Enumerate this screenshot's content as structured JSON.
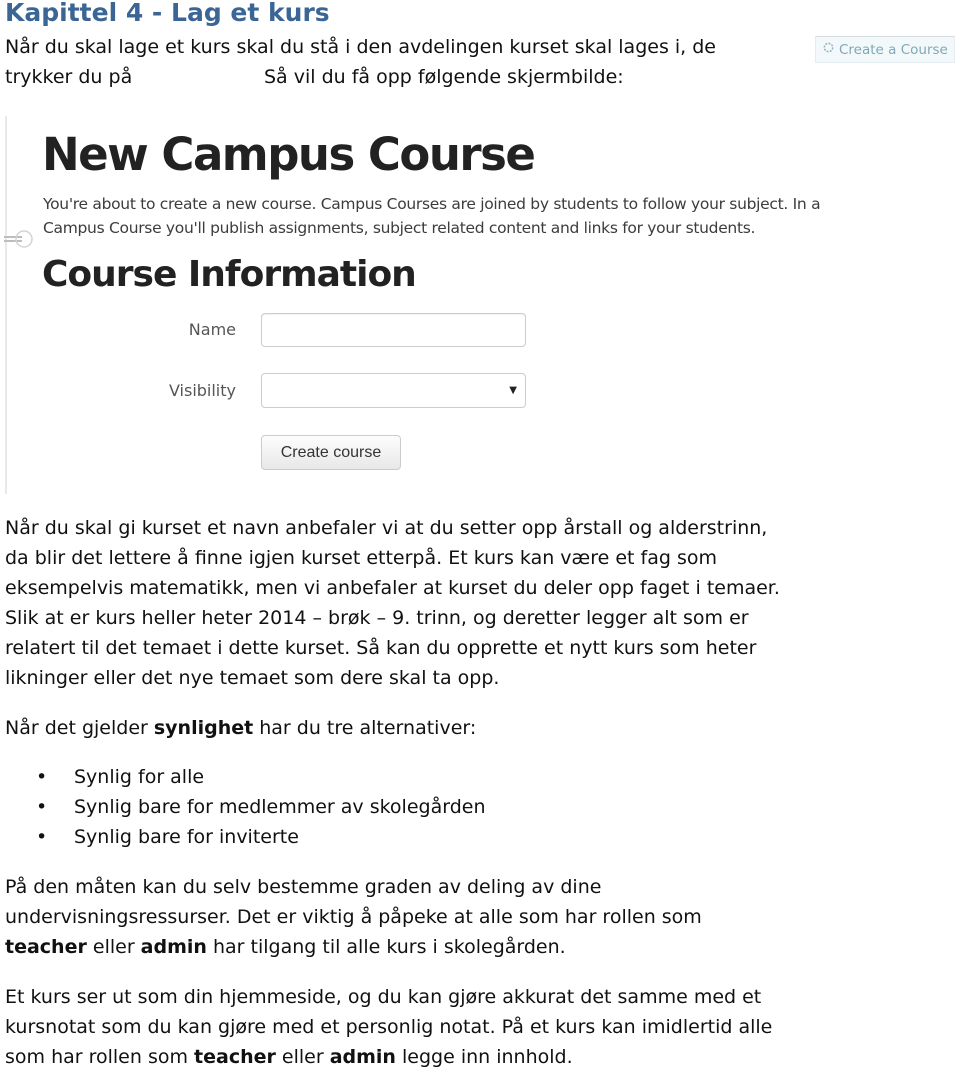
{
  "heading": "Kapittel 4 - Lag et kurs",
  "intro": {
    "line1": "Når du skal lage et kurs skal du stå i den avdelingen kurset skal lages i, de",
    "line2_a": "trykker du på",
    "line2_b": "Så vil du få opp følgende skjermbilde:",
    "inline_button": {
      "icon": "gear-icon",
      "label": "Create a Course"
    }
  },
  "screenshot": {
    "title": "New Campus Course",
    "description_line1": "You're about to create a new course. Campus Courses are joined by students to follow your subject. In a",
    "description_line2": "Campus Course you'll publish assignments, subject related content and links for your students.",
    "section_title": "Course Information",
    "form": {
      "name_label": "Name",
      "name_value": "",
      "visibility_label": "Visibility",
      "visibility_value": "",
      "submit_label": "Create course"
    }
  },
  "paragraphs": {
    "naming": [
      "Når du skal gi kurset et navn anbefaler vi at du setter opp årstall og alderstrinn,",
      "da blir det lettere å finne igjen kurset etterpå. Et kurs kan være et fag som",
      "eksempelvis matematikk, men vi anbefaler at kurset du deler opp faget i temaer.",
      "Slik at er kurs heller heter 2014 – brøk – 9. trinn, og deretter legger alt som er",
      "relatert til det temaet i dette kurset. Så kan du opprette et nytt kurs som heter",
      "likninger eller det nye temaet som dere skal ta opp."
    ],
    "visibility_intro": {
      "before": "Når det gjelder ",
      "bold": "synlighet",
      "after": " har du tre alternativer:"
    },
    "visibility_options": [
      "Synlig for alle",
      "Synlig bare for medlemmer av skolegården",
      "Synlig bare for inviterte"
    ],
    "sharing": {
      "line1": "På den måten kan du selv bestemme graden av deling av dine",
      "line2": "undervisningsressurser. Det er viktig å påpeke at alle som har rollen som",
      "line3_bold1": "teacher",
      "line3_mid": " eller ",
      "line3_bold2": "admin",
      "line3_end": " har tilgang til alle kurs i skolegården."
    },
    "homepage": {
      "line1": "Et kurs ser ut som din hjemmeside, og du kan gjøre akkurat det samme med et",
      "line2": "kursnotat som du kan gjøre med et personlig notat. På et kurs kan imidlertid alle",
      "line3_start": "som har rollen som ",
      "line3_bold1": "teacher",
      "line3_mid": " eller ",
      "line3_bold2": "admin",
      "line3_end": " legge inn innhold."
    }
  },
  "colors": {
    "heading": "#3a6594",
    "inline_button_text": "#7fa8b6"
  }
}
